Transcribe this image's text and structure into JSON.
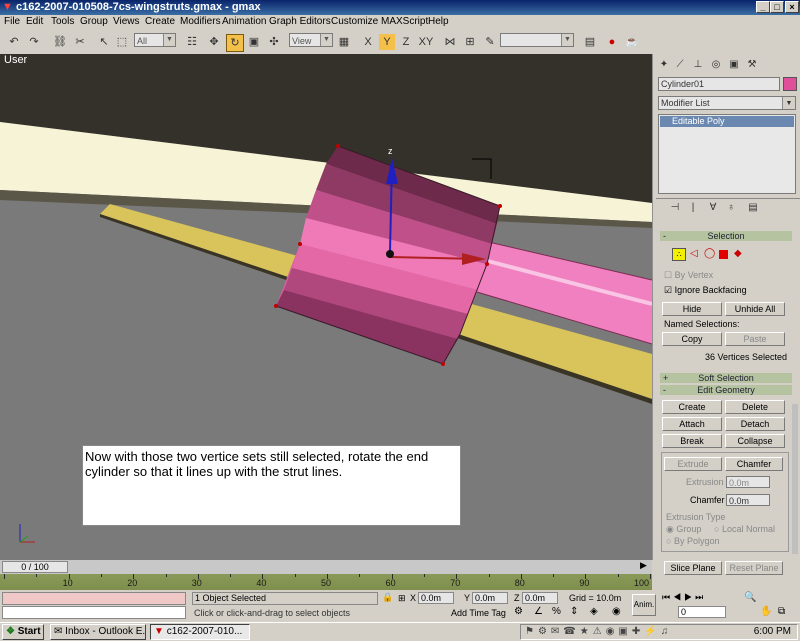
{
  "window": {
    "title": "c162-2007-010508-7cs-wingstruts.gmax - gmax",
    "icon": "gmax-icon",
    "controls": [
      "_",
      "□",
      "×"
    ]
  },
  "menu": [
    "File",
    "Edit",
    "Tools",
    "Group",
    "Views",
    "Create",
    "Modifiers",
    "Animation",
    "Graph Editors",
    "Customize",
    "MAXScript",
    "Help"
  ],
  "toolbar": {
    "selection_filter": "All",
    "reference_coord": "View",
    "named_selection": ""
  },
  "viewport": {
    "label": "User",
    "axis_label": "z",
    "note": "Now with those two vertice sets still selected, rotate the end cylinder so that it lines up with the strut lines.",
    "colors": {
      "background": "#7a7a7a",
      "wing_top": "#34312a",
      "wing_face": "#f6f3d6",
      "strut": "#d8c45a",
      "cylinder_light": "#f070b0",
      "cylinder_dark": "#7a2c50",
      "gizmo_z": "#2020c0",
      "gizmo_x": "#c02020"
    }
  },
  "command_panel": {
    "object_name": "Cylinder01",
    "object_color": "#e0509a",
    "modifier_list": "Modifier List",
    "stack_items": [
      "Editable Poly"
    ],
    "selection": {
      "title": "Selection",
      "by_vertex": "By Vertex",
      "ignore_backfacing": "Ignore Backfacing",
      "hide": "Hide",
      "unhide_all": "Unhide All",
      "named_selections": "Named Selections:",
      "copy": "Copy",
      "paste": "Paste",
      "status": "36 Vertices Selected"
    },
    "soft_selection": "Soft Selection",
    "edit_geometry": {
      "title": "Edit Geometry",
      "create": "Create",
      "delete": "Delete",
      "attach": "Attach",
      "detach": "Detach",
      "break": "Break",
      "collapse": "Collapse",
      "extrude": "Extrude",
      "chamfer": "Chamfer",
      "extrusion_label": "Extrusion",
      "extrusion_value": "0.0m",
      "chamfer_label": "Chamfer",
      "chamfer_value": "0.0m",
      "extrusion_type": "Extrusion Type",
      "group": "Group",
      "local_normal": "Local Normal",
      "by_polygon": "By Polygon",
      "slice_plane": "Slice Plane",
      "reset_plane": "Reset Plane"
    }
  },
  "timeline": {
    "frame": "0 / 100",
    "ticks": [
      "10",
      "20",
      "30",
      "40",
      "50",
      "60",
      "70",
      "80",
      "90",
      "100"
    ]
  },
  "statusbar": {
    "selected": "1 Object Selected",
    "prompt": "Click or click-and-drag to select objects",
    "x": "0.0m",
    "y": "0.0m",
    "z": "0.0m",
    "x_label": "X",
    "y_label": "Y",
    "z_label": "Z",
    "grid": "Grid = 10.0m",
    "add_time_tag": "Add Time Tag",
    "anim": "Anim.",
    "frame_field": "0"
  },
  "taskbar": {
    "start": "Start",
    "tasks": [
      "Inbox - Outlook E...",
      "c162-2007-010..."
    ],
    "clock": "6:00 PM"
  }
}
